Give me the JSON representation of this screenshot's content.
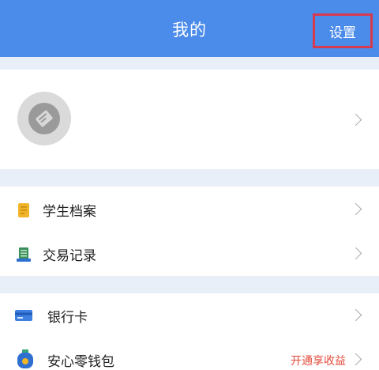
{
  "header": {
    "title": "我的",
    "settings_label": "设置"
  },
  "profile": {
    "avatar_icon": "avatar-icon"
  },
  "section1": [
    {
      "label": "学生档案",
      "icon": "student-file-icon"
    },
    {
      "label": "交易记录",
      "icon": "transaction-record-icon"
    }
  ],
  "section2": [
    {
      "label": "银行卡",
      "icon": "bank-card-icon"
    },
    {
      "label": "安心零钱包",
      "icon": "wallet-icon",
      "extra": "开通享收益"
    }
  ],
  "colors": {
    "header_bg": "#4b8bea",
    "highlight_border": "#d63a4f",
    "promo_text": "#e44b3a",
    "divider_bg": "#e8eff8"
  }
}
